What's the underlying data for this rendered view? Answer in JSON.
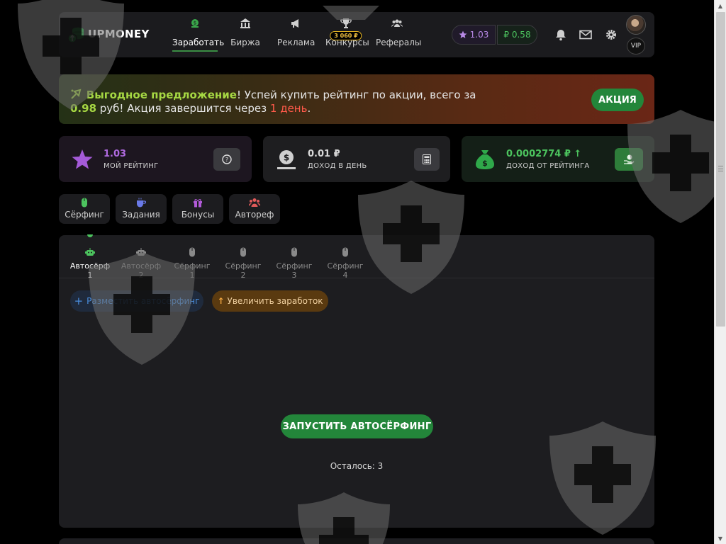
{
  "brand": {
    "name": "UPMONEY"
  },
  "nav": {
    "items": [
      {
        "label": "Заработать",
        "icon": "money-stack-icon",
        "active": true
      },
      {
        "label": "Биржа",
        "icon": "bank-icon",
        "active": false
      },
      {
        "label": "Реклама",
        "icon": "megaphone-icon",
        "active": false
      },
      {
        "label": "Конкурсы",
        "icon": "trophy-icon",
        "active": false,
        "badge": "3 060 ₽"
      },
      {
        "label": "Рефералы",
        "icon": "users-icon",
        "active": false
      }
    ]
  },
  "header": {
    "rating": "1.03",
    "balance": "₽ 0.58",
    "vip": "VIP",
    "icons": [
      "bell-icon",
      "envelope-icon",
      "gear-icon"
    ]
  },
  "banner": {
    "highlight": "Выгодное предложение",
    "text1": "! Успей купить рейтинг по акции, всего за",
    "price": "0.98",
    "text2": " руб! Акция завершится через ",
    "deadline": "1 день",
    "text3": ".",
    "button": "АКЦИЯ"
  },
  "stats": [
    {
      "value": "1.03",
      "label": "МОЙ РЕЙТИНГ",
      "icon": "star-icon",
      "color": "#a45ad8"
    },
    {
      "value": "0.01 ₽",
      "label": "ДОХОД В ДЕНЬ",
      "icon": "coin-hand-icon",
      "color": "#cfcfcf"
    },
    {
      "value": "0.0002774 ₽",
      "label": "ДОХОД ОТ РЕЙТИНГА",
      "icon": "money-bag-icon",
      "color": "#4cc35e"
    }
  ],
  "section_tabs": [
    {
      "label": "Сёрфинг",
      "icon": "mouse-icon",
      "color": "#4cc35e"
    },
    {
      "label": "Задания",
      "icon": "cup-icon",
      "color": "#6a7ae8"
    },
    {
      "label": "Бонусы",
      "icon": "gift-icon",
      "color": "#b15ad8"
    },
    {
      "label": "Автореф",
      "icon": "users-icon",
      "color": "#e05a5a"
    }
  ],
  "sub_tabs": [
    {
      "label": "Автосёрф 1",
      "icon": "robot-icon",
      "active": true
    },
    {
      "label": "Автосёрф 2",
      "icon": "robot-icon",
      "active": false
    },
    {
      "label": "Сёрфинг 1",
      "icon": "mouse-icon",
      "active": false
    },
    {
      "label": "Сёрфинг 2",
      "icon": "mouse-icon",
      "active": false
    },
    {
      "label": "Сёрфинг 3",
      "icon": "mouse-icon",
      "active": false
    },
    {
      "label": "Сёрфинг 4",
      "icon": "mouse-icon",
      "active": false
    }
  ],
  "actions": {
    "place": "Разместить автосёрфинг",
    "boost": "Увеличить заработок",
    "start": "ЗАПУСТИТЬ АВТОСЁРФИНГ",
    "remaining": "Осталось: 3"
  },
  "colors": {
    "accent": "#23863a",
    "panel": "#1d1d20",
    "rating": "#a45ad8"
  }
}
